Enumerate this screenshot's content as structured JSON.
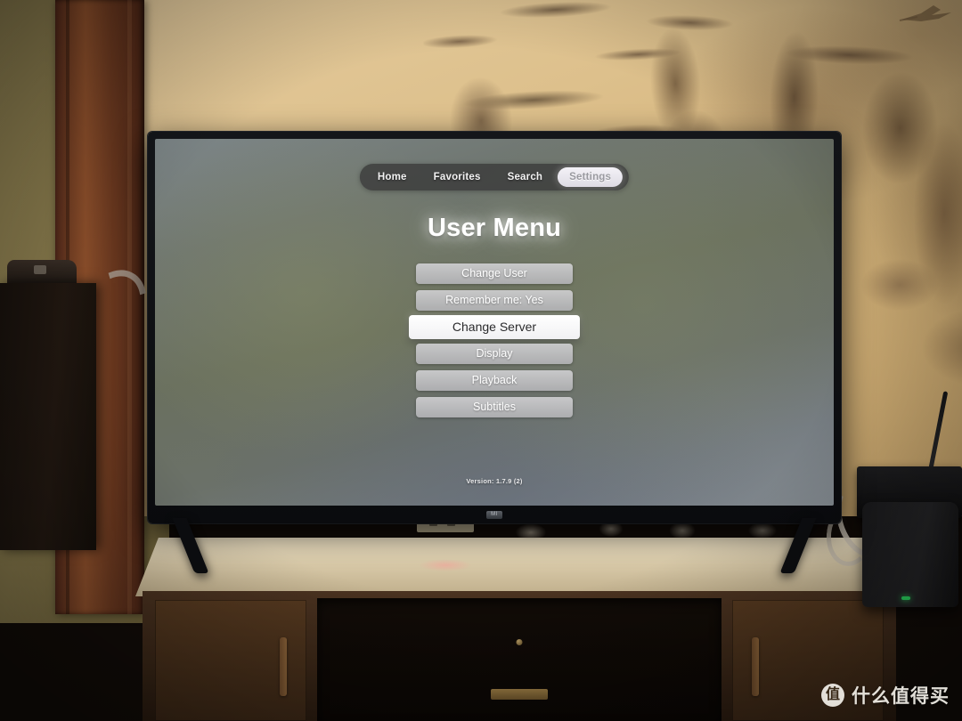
{
  "app": {
    "navbar": {
      "items": [
        {
          "label": "Home",
          "selected": false
        },
        {
          "label": "Favorites",
          "selected": false
        },
        {
          "label": "Search",
          "selected": false
        },
        {
          "label": "Settings",
          "selected": true
        }
      ]
    },
    "page_title": "User Menu",
    "menu_buttons": [
      {
        "label": "Change User",
        "focused": false
      },
      {
        "label": "Remember me: Yes",
        "focused": false
      },
      {
        "label": "Change Server",
        "focused": true
      },
      {
        "label": "Display",
        "focused": false
      },
      {
        "label": "Playback",
        "focused": false
      },
      {
        "label": "Subtitles",
        "focused": false
      }
    ],
    "version": "Version: 1.7.9 (2)"
  },
  "device": {
    "tv_brand_logo": "MI"
  },
  "watermark": {
    "logo_char": "值",
    "text": "什么值得买"
  },
  "colors": {
    "focus_background": "#ffffff",
    "focus_text": "#2b2b2d",
    "button_background": "#cfcfd1",
    "button_text": "#ffffff",
    "navbar_background": "#3a3a3a",
    "selected_pill": "#f4f2f7",
    "screen_tint": "#6b7169",
    "status_led": "#2ad860"
  }
}
